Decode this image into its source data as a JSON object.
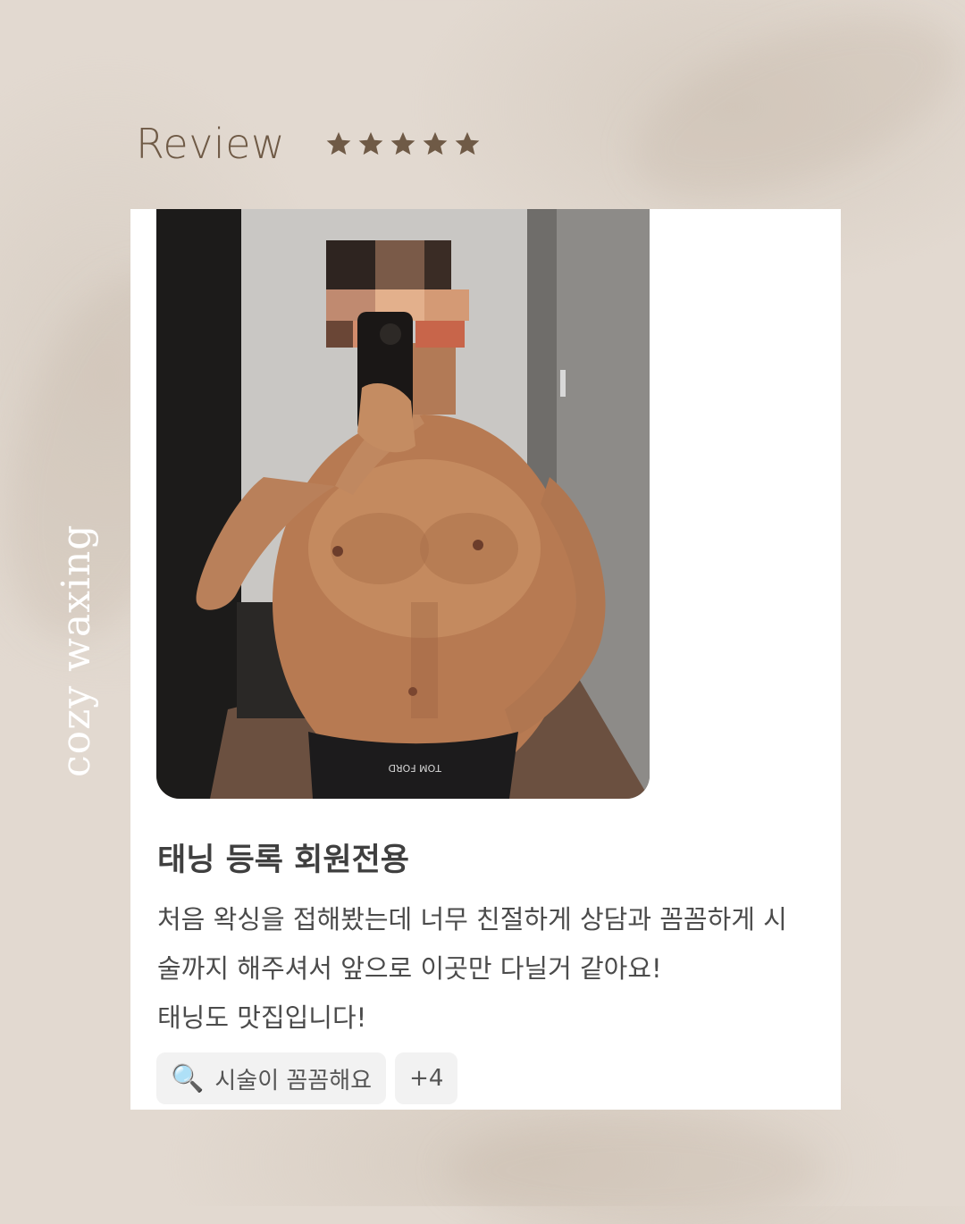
{
  "header": {
    "title": "Review",
    "rating": 5,
    "star_color": "#6f5a46"
  },
  "brand": {
    "vertical_text": "cozy waxing"
  },
  "review": {
    "title": "태닝 등록 회원전용",
    "body_lines": [
      "처음 왁싱을 접해봤는데 너무 친절하게 상담과 꼼꼼하게 시",
      "술까지 해주셔서 앞으로 이곳만 다닐거 같아요!",
      "태닝도 맛집입니다!"
    ],
    "tags": [
      {
        "icon": "magnifier-icon",
        "glyph": "🔍",
        "label": "시술이 꼼꼼해요"
      },
      {
        "label": "+4"
      }
    ],
    "photo": {
      "waistband_text": "TOM FORD"
    }
  }
}
